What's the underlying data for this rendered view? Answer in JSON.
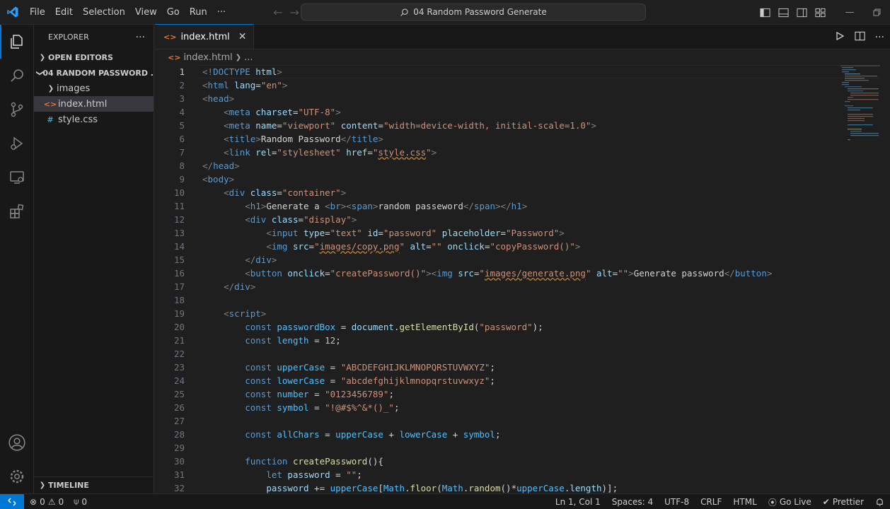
{
  "titlebar": {
    "menu": [
      "File",
      "Edit",
      "Selection",
      "View",
      "Go",
      "Run",
      "···"
    ],
    "search_text": "04 Random Password Generate",
    "window_controls": [
      "minimize-icon",
      "restore-icon"
    ]
  },
  "sidebar": {
    "title": "EXPLORER",
    "more": "···",
    "open_editors": "OPEN EDITORS",
    "folder": "04 RANDOM PASSWORD ...",
    "items": [
      {
        "label": "images",
        "type": "folder"
      },
      {
        "label": "index.html",
        "type": "html"
      },
      {
        "label": "style.css",
        "type": "css"
      }
    ],
    "timeline": "TIMELINE"
  },
  "editor": {
    "tab_label": "index.html",
    "breadcrumb_file": "index.html",
    "breadcrumb_more": "...",
    "line_numbers": [
      "1",
      "2",
      "3",
      "4",
      "5",
      "6",
      "7",
      "8",
      "9",
      "10",
      "11",
      "12",
      "13",
      "14",
      "15",
      "16",
      "17",
      "18",
      "19",
      "20",
      "21",
      "22",
      "23",
      "24",
      "25",
      "26",
      "27",
      "28",
      "29",
      "30",
      "31",
      "32"
    ],
    "lines": [
      [
        [
          "pu",
          "<!"
        ],
        [
          "tg",
          "DOCTYPE"
        ],
        [
          "at",
          " html"
        ],
        [
          "pu",
          ">"
        ]
      ],
      [
        [
          "pu",
          "<"
        ],
        [
          "tg",
          "html"
        ],
        [
          "at",
          " lang"
        ],
        [
          "tx",
          "="
        ],
        [
          "st",
          "\"en\""
        ],
        [
          "pu",
          ">"
        ]
      ],
      [
        [
          "pu",
          "<"
        ],
        [
          "tg",
          "head"
        ],
        [
          "pu",
          ">"
        ]
      ],
      [
        [
          "tx",
          "    "
        ],
        [
          "pu",
          "<"
        ],
        [
          "tg",
          "meta"
        ],
        [
          "at",
          " charset"
        ],
        [
          "tx",
          "="
        ],
        [
          "st",
          "\"UTF-8\""
        ],
        [
          "pu",
          ">"
        ]
      ],
      [
        [
          "tx",
          "    "
        ],
        [
          "pu",
          "<"
        ],
        [
          "tg",
          "meta"
        ],
        [
          "at",
          " name"
        ],
        [
          "tx",
          "="
        ],
        [
          "st",
          "\"viewport\""
        ],
        [
          "at",
          " content"
        ],
        [
          "tx",
          "="
        ],
        [
          "st",
          "\"width=device-width, initial-scale=1.0\""
        ],
        [
          "pu",
          ">"
        ]
      ],
      [
        [
          "tx",
          "    "
        ],
        [
          "pu",
          "<"
        ],
        [
          "tg",
          "title"
        ],
        [
          "pu",
          ">"
        ],
        [
          "tx",
          "Random Password"
        ],
        [
          "pu",
          "</"
        ],
        [
          "tg",
          "title"
        ],
        [
          "pu",
          ">"
        ]
      ],
      [
        [
          "tx",
          "    "
        ],
        [
          "pu",
          "<"
        ],
        [
          "tg",
          "link"
        ],
        [
          "at",
          " rel"
        ],
        [
          "tx",
          "="
        ],
        [
          "st",
          "\"stylesheet\""
        ],
        [
          "at",
          " href"
        ],
        [
          "tx",
          "="
        ],
        [
          "st",
          "\""
        ],
        [
          "st ul",
          "style.css"
        ],
        [
          "st",
          "\""
        ],
        [
          "pu",
          ">"
        ]
      ],
      [
        [
          "pu",
          "</"
        ],
        [
          "tg",
          "head"
        ],
        [
          "pu",
          ">"
        ]
      ],
      [
        [
          "pu",
          "<"
        ],
        [
          "tg",
          "body"
        ],
        [
          "pu",
          ">"
        ]
      ],
      [
        [
          "tx",
          "    "
        ],
        [
          "pu",
          "<"
        ],
        [
          "tg",
          "div"
        ],
        [
          "at",
          " class"
        ],
        [
          "tx",
          "="
        ],
        [
          "st",
          "\"container\""
        ],
        [
          "pu",
          ">"
        ]
      ],
      [
        [
          "tx",
          "        "
        ],
        [
          "pu",
          "<"
        ],
        [
          "tg",
          "h1"
        ],
        [
          "pu",
          ">"
        ],
        [
          "tx",
          "Generate a "
        ],
        [
          "pu",
          "<"
        ],
        [
          "tg",
          "br"
        ],
        [
          "pu",
          ">"
        ],
        [
          "pu",
          "<"
        ],
        [
          "tg",
          "span"
        ],
        [
          "pu",
          ">"
        ],
        [
          "tx",
          "random passeword"
        ],
        [
          "pu",
          "</"
        ],
        [
          "tg",
          "span"
        ],
        [
          "pu",
          ">"
        ],
        [
          "pu",
          "</"
        ],
        [
          "tg",
          "h1"
        ],
        [
          "pu",
          ">"
        ]
      ],
      [
        [
          "tx",
          "        "
        ],
        [
          "pu",
          "<"
        ],
        [
          "tg",
          "div"
        ],
        [
          "at",
          " class"
        ],
        [
          "tx",
          "="
        ],
        [
          "st",
          "\"display\""
        ],
        [
          "pu",
          ">"
        ]
      ],
      [
        [
          "tx",
          "            "
        ],
        [
          "pu",
          "<"
        ],
        [
          "tg",
          "input"
        ],
        [
          "at",
          " type"
        ],
        [
          "tx",
          "="
        ],
        [
          "st",
          "\"text\""
        ],
        [
          "at",
          " id"
        ],
        [
          "tx",
          "="
        ],
        [
          "st",
          "\"password\""
        ],
        [
          "at",
          " placeholder"
        ],
        [
          "tx",
          "="
        ],
        [
          "st",
          "\"Password\""
        ],
        [
          "pu",
          ">"
        ]
      ],
      [
        [
          "tx",
          "            "
        ],
        [
          "pu",
          "<"
        ],
        [
          "tg",
          "img"
        ],
        [
          "at",
          " src"
        ],
        [
          "tx",
          "="
        ],
        [
          "st",
          "\""
        ],
        [
          "st ul",
          "images/copy.png"
        ],
        [
          "st",
          "\""
        ],
        [
          "at",
          " alt"
        ],
        [
          "tx",
          "="
        ],
        [
          "st",
          "\"\""
        ],
        [
          "at",
          " onclick"
        ],
        [
          "tx",
          "="
        ],
        [
          "st",
          "\"copyPassword()\""
        ],
        [
          "pu",
          ">"
        ]
      ],
      [
        [
          "tx",
          "        "
        ],
        [
          "pu",
          "</"
        ],
        [
          "tg",
          "div"
        ],
        [
          "pu",
          ">"
        ]
      ],
      [
        [
          "tx",
          "        "
        ],
        [
          "pu",
          "<"
        ],
        [
          "tg",
          "button"
        ],
        [
          "at",
          " onclick"
        ],
        [
          "tx",
          "="
        ],
        [
          "st",
          "\"createPassword()\""
        ],
        [
          "pu",
          ">"
        ],
        [
          "pu",
          "<"
        ],
        [
          "tg",
          "img"
        ],
        [
          "at",
          " src"
        ],
        [
          "tx",
          "="
        ],
        [
          "st",
          "\""
        ],
        [
          "st ul",
          "images/generate.png"
        ],
        [
          "st",
          "\""
        ],
        [
          "at",
          " alt"
        ],
        [
          "tx",
          "="
        ],
        [
          "st",
          "\"\""
        ],
        [
          "pu",
          ">"
        ],
        [
          "tx",
          "Generate password"
        ],
        [
          "pu",
          "</"
        ],
        [
          "tg",
          "button"
        ],
        [
          "pu",
          ">"
        ]
      ],
      [
        [
          "tx",
          "    "
        ],
        [
          "pu",
          "</"
        ],
        [
          "tg",
          "div"
        ],
        [
          "pu",
          ">"
        ]
      ],
      [
        [
          "tx",
          ""
        ]
      ],
      [
        [
          "tx",
          "    "
        ],
        [
          "pu",
          "<"
        ],
        [
          "tg",
          "script"
        ],
        [
          "pu",
          ">"
        ]
      ],
      [
        [
          "tx",
          "        "
        ],
        [
          "kw",
          "const"
        ],
        [
          "va",
          " passwordBox"
        ],
        [
          "op",
          " = "
        ],
        [
          "vr",
          "document"
        ],
        [
          "op",
          "."
        ],
        [
          "fn",
          "getElementById"
        ],
        [
          "op",
          "("
        ],
        [
          "st",
          "\"password\""
        ],
        [
          "op",
          ");"
        ]
      ],
      [
        [
          "tx",
          "        "
        ],
        [
          "kw",
          "const"
        ],
        [
          "va",
          " length"
        ],
        [
          "op",
          " = "
        ],
        [
          "nm",
          "12"
        ],
        [
          "op",
          ";"
        ]
      ],
      [
        [
          "tx",
          ""
        ]
      ],
      [
        [
          "tx",
          "        "
        ],
        [
          "kw",
          "const"
        ],
        [
          "va",
          " upperCase"
        ],
        [
          "op",
          " = "
        ],
        [
          "st",
          "\"ABCDEFGHIJKLMNOPQRSTUVWXYZ\""
        ],
        [
          "op",
          ";"
        ]
      ],
      [
        [
          "tx",
          "        "
        ],
        [
          "kw",
          "const"
        ],
        [
          "va",
          " lowerCase"
        ],
        [
          "op",
          " = "
        ],
        [
          "st",
          "\"abcdefghijklmnopqrstuvwxyz\""
        ],
        [
          "op",
          ";"
        ]
      ],
      [
        [
          "tx",
          "        "
        ],
        [
          "kw",
          "const"
        ],
        [
          "va",
          " number"
        ],
        [
          "op",
          " = "
        ],
        [
          "st",
          "\"0123456789\""
        ],
        [
          "op",
          ";"
        ]
      ],
      [
        [
          "tx",
          "        "
        ],
        [
          "kw",
          "const"
        ],
        [
          "va",
          " symbol"
        ],
        [
          "op",
          " = "
        ],
        [
          "st",
          "\"!@#$%^&*()_\""
        ],
        [
          "op",
          ";"
        ]
      ],
      [
        [
          "tx",
          ""
        ]
      ],
      [
        [
          "tx",
          "        "
        ],
        [
          "kw",
          "const"
        ],
        [
          "va",
          " allChars"
        ],
        [
          "op",
          " = "
        ],
        [
          "va",
          "upperCase"
        ],
        [
          "op",
          " + "
        ],
        [
          "va",
          "lowerCase"
        ],
        [
          "op",
          " + "
        ],
        [
          "va",
          "symbol"
        ],
        [
          "op",
          ";"
        ]
      ],
      [
        [
          "tx",
          ""
        ]
      ],
      [
        [
          "tx",
          "        "
        ],
        [
          "kw",
          "function"
        ],
        [
          "fn",
          " createPassword"
        ],
        [
          "op",
          "(){"
        ]
      ],
      [
        [
          "tx",
          "            "
        ],
        [
          "kw",
          "let"
        ],
        [
          "vr",
          " password"
        ],
        [
          "op",
          " = "
        ],
        [
          "st",
          "\"\""
        ],
        [
          "op",
          ";"
        ]
      ],
      [
        [
          "tx",
          "            "
        ],
        [
          "vr",
          "password"
        ],
        [
          "op",
          " += "
        ],
        [
          "va",
          "upperCase"
        ],
        [
          "op",
          "["
        ],
        [
          "va",
          "Math"
        ],
        [
          "op",
          "."
        ],
        [
          "fn",
          "floor"
        ],
        [
          "op",
          "("
        ],
        [
          "va",
          "Math"
        ],
        [
          "op",
          "."
        ],
        [
          "fn",
          "random"
        ],
        [
          "op",
          "()*"
        ],
        [
          "va",
          "upperCase"
        ],
        [
          "op",
          "."
        ],
        [
          "vr",
          "length"
        ],
        [
          "op",
          ")];"
        ]
      ]
    ]
  },
  "statusbar": {
    "errors": "0",
    "warnings": "0",
    "ports": "0",
    "position": "Ln 1, Col 1",
    "spaces": "Spaces: 4",
    "encoding": "UTF-8",
    "eol": "CRLF",
    "language": "HTML",
    "golive": "Go Live",
    "prettier": "Prettier"
  },
  "colors": {
    "accent": "#0078d4",
    "background": "#1f1f1f",
    "sidebar": "#181818"
  }
}
